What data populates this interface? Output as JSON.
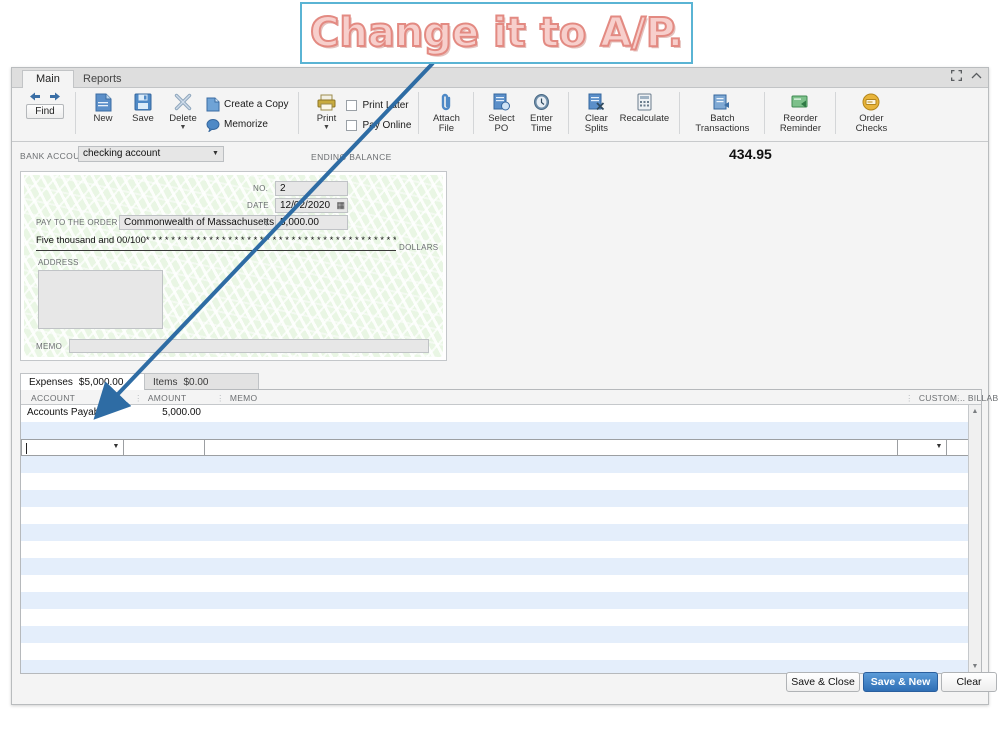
{
  "callout": {
    "text": "Change it to A/P."
  },
  "window": {
    "tabs": [
      {
        "label": "Main",
        "active": true
      },
      {
        "label": "Reports",
        "active": false
      }
    ],
    "controls": {
      "maximize": "maximize-icon",
      "collapse": "chevron-up-icon"
    }
  },
  "ribbon": {
    "find_label": "Find",
    "nav_back": "back-arrow-icon",
    "nav_forward": "forward-arrow-icon",
    "items": [
      {
        "label": "New",
        "icon": "new-document-icon"
      },
      {
        "label": "Save",
        "icon": "save-disk-icon"
      },
      {
        "label": "Delete",
        "icon": "delete-x-icon",
        "has_caret": true
      },
      {
        "label": "Create a Copy",
        "icon": "copy-icon"
      },
      {
        "label": "Memorize",
        "icon": "memorize-icon"
      },
      {
        "label": "Print",
        "icon": "printer-icon",
        "has_caret": true
      },
      {
        "label": "Print Later",
        "icon": "checkbox",
        "checked": false
      },
      {
        "label": "Pay Online",
        "icon": "checkbox",
        "checked": false
      },
      {
        "label": "Attach\nFile",
        "icon": "paperclip-icon"
      },
      {
        "label": "Select\nPO",
        "icon": "select-po-icon"
      },
      {
        "label": "Enter\nTime",
        "icon": "clock-icon"
      },
      {
        "label": "Clear\nSplits",
        "icon": "clear-splits-icon"
      },
      {
        "label": "Recalculate",
        "icon": "calculator-icon"
      },
      {
        "label": "Batch\nTransactions",
        "icon": "batch-transactions-icon"
      },
      {
        "label": "Reorder\nReminder",
        "icon": "reorder-reminder-icon"
      },
      {
        "label": "Order\nChecks",
        "icon": "order-checks-icon"
      }
    ]
  },
  "bank": {
    "label": "BANK ACCOUNT",
    "account": "checking account",
    "balance_label": "ENDING BALANCE",
    "balance_value": "434.95"
  },
  "check": {
    "no_label": "NO.",
    "no_value": "2",
    "date_label": "DATE",
    "date_value": "12/02/2020",
    "currency_symbol": "$",
    "amount_value": "5,000.00",
    "payee_label": "PAY TO THE ORDER OF",
    "payee_value": "Commonwealth of Massachusetts",
    "amount_words": "Five thousand  and 00/100* * * * * * * * * * * * * * * * * * * * * * * * * * * * * * * * * * * * * * * * * * * * * * * * * * * * * * * * * * * * * *",
    "dollars_label": "DOLLARS",
    "address_label": "ADDRESS",
    "address_value": "",
    "memo_label": "MEMO",
    "memo_value": ""
  },
  "detail_tabs": [
    {
      "name": "Expenses",
      "total": "$5,000.00",
      "active": true
    },
    {
      "name": "Items",
      "total": "$0.00",
      "active": false
    }
  ],
  "grid": {
    "columns": [
      "ACCOUNT",
      "AMOUNT",
      "MEMO",
      "CUSTOM...",
      "BILLABL..."
    ],
    "rows": [
      {
        "account": "Accounts Payable",
        "amount": "5,000.00",
        "memo": "",
        "customer": "",
        "billable": ""
      }
    ],
    "active_row_placeholder": ""
  },
  "footer": {
    "buttons": [
      {
        "label": "Save & Close",
        "primary": false
      },
      {
        "label": "Save & New",
        "primary": true
      },
      {
        "label": "Clear",
        "primary": false
      }
    ]
  },
  "colors": {
    "accent_blue": "#2f6fb5",
    "callout_border": "#5ab4d4",
    "callout_text": "#f7cfcc",
    "check_green": "#e9f6e4",
    "row_stripe": "#e4eefb",
    "arrow": "#2e6ca4"
  }
}
